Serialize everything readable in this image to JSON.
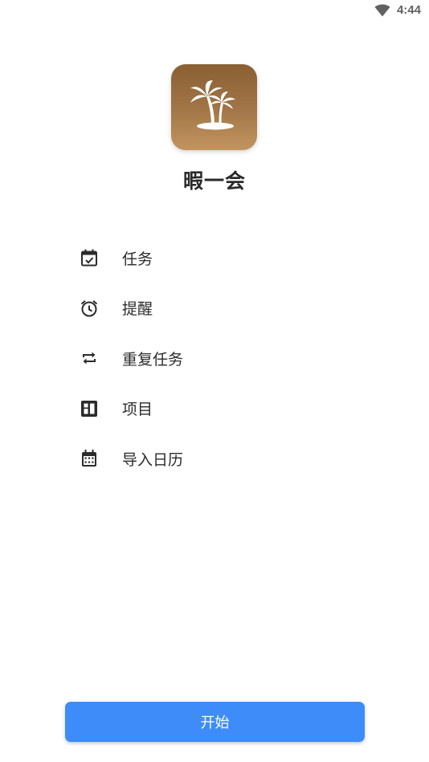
{
  "status_bar": {
    "time": "4:44",
    "wifi_icon": "wifi-icon"
  },
  "app": {
    "icon": "palm-island-icon",
    "name": "暇一会",
    "icon_gradient": [
      "#8a6033",
      "#c2945f"
    ]
  },
  "features": [
    {
      "icon": "calendar-check-icon",
      "label": "任务"
    },
    {
      "icon": "alarm-clock-icon",
      "label": "提醒"
    },
    {
      "icon": "repeat-icon",
      "label": "重复任务"
    },
    {
      "icon": "project-board-icon",
      "label": "项目"
    },
    {
      "icon": "calendar-grid-icon",
      "label": "导入日历"
    }
  ],
  "start_button": {
    "label": "开始",
    "color": "#3d8cf9"
  }
}
